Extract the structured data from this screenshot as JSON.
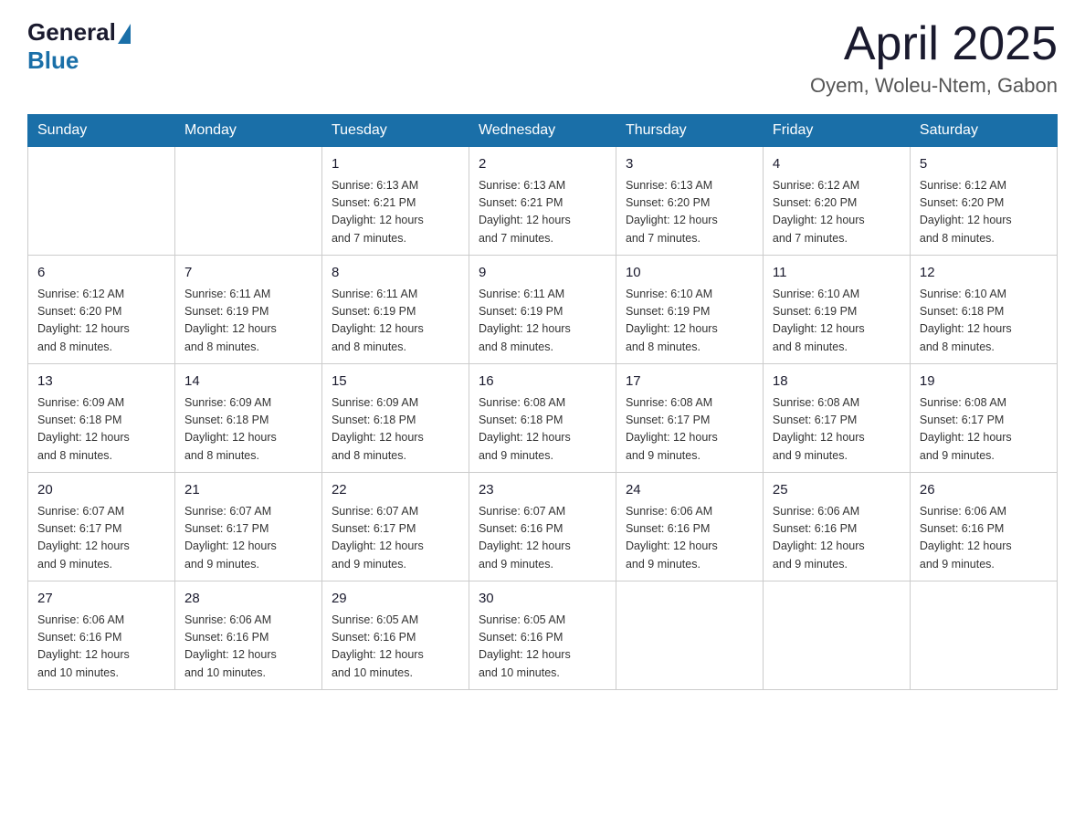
{
  "header": {
    "logo_general": "General",
    "logo_blue": "Blue",
    "month_title": "April 2025",
    "location": "Oyem, Woleu-Ntem, Gabon"
  },
  "weekdays": [
    "Sunday",
    "Monday",
    "Tuesday",
    "Wednesday",
    "Thursday",
    "Friday",
    "Saturday"
  ],
  "weeks": [
    [
      {
        "day": "",
        "info": ""
      },
      {
        "day": "",
        "info": ""
      },
      {
        "day": "1",
        "info": "Sunrise: 6:13 AM\nSunset: 6:21 PM\nDaylight: 12 hours\nand 7 minutes."
      },
      {
        "day": "2",
        "info": "Sunrise: 6:13 AM\nSunset: 6:21 PM\nDaylight: 12 hours\nand 7 minutes."
      },
      {
        "day": "3",
        "info": "Sunrise: 6:13 AM\nSunset: 6:20 PM\nDaylight: 12 hours\nand 7 minutes."
      },
      {
        "day": "4",
        "info": "Sunrise: 6:12 AM\nSunset: 6:20 PM\nDaylight: 12 hours\nand 7 minutes."
      },
      {
        "day": "5",
        "info": "Sunrise: 6:12 AM\nSunset: 6:20 PM\nDaylight: 12 hours\nand 8 minutes."
      }
    ],
    [
      {
        "day": "6",
        "info": "Sunrise: 6:12 AM\nSunset: 6:20 PM\nDaylight: 12 hours\nand 8 minutes."
      },
      {
        "day": "7",
        "info": "Sunrise: 6:11 AM\nSunset: 6:19 PM\nDaylight: 12 hours\nand 8 minutes."
      },
      {
        "day": "8",
        "info": "Sunrise: 6:11 AM\nSunset: 6:19 PM\nDaylight: 12 hours\nand 8 minutes."
      },
      {
        "day": "9",
        "info": "Sunrise: 6:11 AM\nSunset: 6:19 PM\nDaylight: 12 hours\nand 8 minutes."
      },
      {
        "day": "10",
        "info": "Sunrise: 6:10 AM\nSunset: 6:19 PM\nDaylight: 12 hours\nand 8 minutes."
      },
      {
        "day": "11",
        "info": "Sunrise: 6:10 AM\nSunset: 6:19 PM\nDaylight: 12 hours\nand 8 minutes."
      },
      {
        "day": "12",
        "info": "Sunrise: 6:10 AM\nSunset: 6:18 PM\nDaylight: 12 hours\nand 8 minutes."
      }
    ],
    [
      {
        "day": "13",
        "info": "Sunrise: 6:09 AM\nSunset: 6:18 PM\nDaylight: 12 hours\nand 8 minutes."
      },
      {
        "day": "14",
        "info": "Sunrise: 6:09 AM\nSunset: 6:18 PM\nDaylight: 12 hours\nand 8 minutes."
      },
      {
        "day": "15",
        "info": "Sunrise: 6:09 AM\nSunset: 6:18 PM\nDaylight: 12 hours\nand 8 minutes."
      },
      {
        "day": "16",
        "info": "Sunrise: 6:08 AM\nSunset: 6:18 PM\nDaylight: 12 hours\nand 9 minutes."
      },
      {
        "day": "17",
        "info": "Sunrise: 6:08 AM\nSunset: 6:17 PM\nDaylight: 12 hours\nand 9 minutes."
      },
      {
        "day": "18",
        "info": "Sunrise: 6:08 AM\nSunset: 6:17 PM\nDaylight: 12 hours\nand 9 minutes."
      },
      {
        "day": "19",
        "info": "Sunrise: 6:08 AM\nSunset: 6:17 PM\nDaylight: 12 hours\nand 9 minutes."
      }
    ],
    [
      {
        "day": "20",
        "info": "Sunrise: 6:07 AM\nSunset: 6:17 PM\nDaylight: 12 hours\nand 9 minutes."
      },
      {
        "day": "21",
        "info": "Sunrise: 6:07 AM\nSunset: 6:17 PM\nDaylight: 12 hours\nand 9 minutes."
      },
      {
        "day": "22",
        "info": "Sunrise: 6:07 AM\nSunset: 6:17 PM\nDaylight: 12 hours\nand 9 minutes."
      },
      {
        "day": "23",
        "info": "Sunrise: 6:07 AM\nSunset: 6:16 PM\nDaylight: 12 hours\nand 9 minutes."
      },
      {
        "day": "24",
        "info": "Sunrise: 6:06 AM\nSunset: 6:16 PM\nDaylight: 12 hours\nand 9 minutes."
      },
      {
        "day": "25",
        "info": "Sunrise: 6:06 AM\nSunset: 6:16 PM\nDaylight: 12 hours\nand 9 minutes."
      },
      {
        "day": "26",
        "info": "Sunrise: 6:06 AM\nSunset: 6:16 PM\nDaylight: 12 hours\nand 9 minutes."
      }
    ],
    [
      {
        "day": "27",
        "info": "Sunrise: 6:06 AM\nSunset: 6:16 PM\nDaylight: 12 hours\nand 10 minutes."
      },
      {
        "day": "28",
        "info": "Sunrise: 6:06 AM\nSunset: 6:16 PM\nDaylight: 12 hours\nand 10 minutes."
      },
      {
        "day": "29",
        "info": "Sunrise: 6:05 AM\nSunset: 6:16 PM\nDaylight: 12 hours\nand 10 minutes."
      },
      {
        "day": "30",
        "info": "Sunrise: 6:05 AM\nSunset: 6:16 PM\nDaylight: 12 hours\nand 10 minutes."
      },
      {
        "day": "",
        "info": ""
      },
      {
        "day": "",
        "info": ""
      },
      {
        "day": "",
        "info": ""
      }
    ]
  ]
}
